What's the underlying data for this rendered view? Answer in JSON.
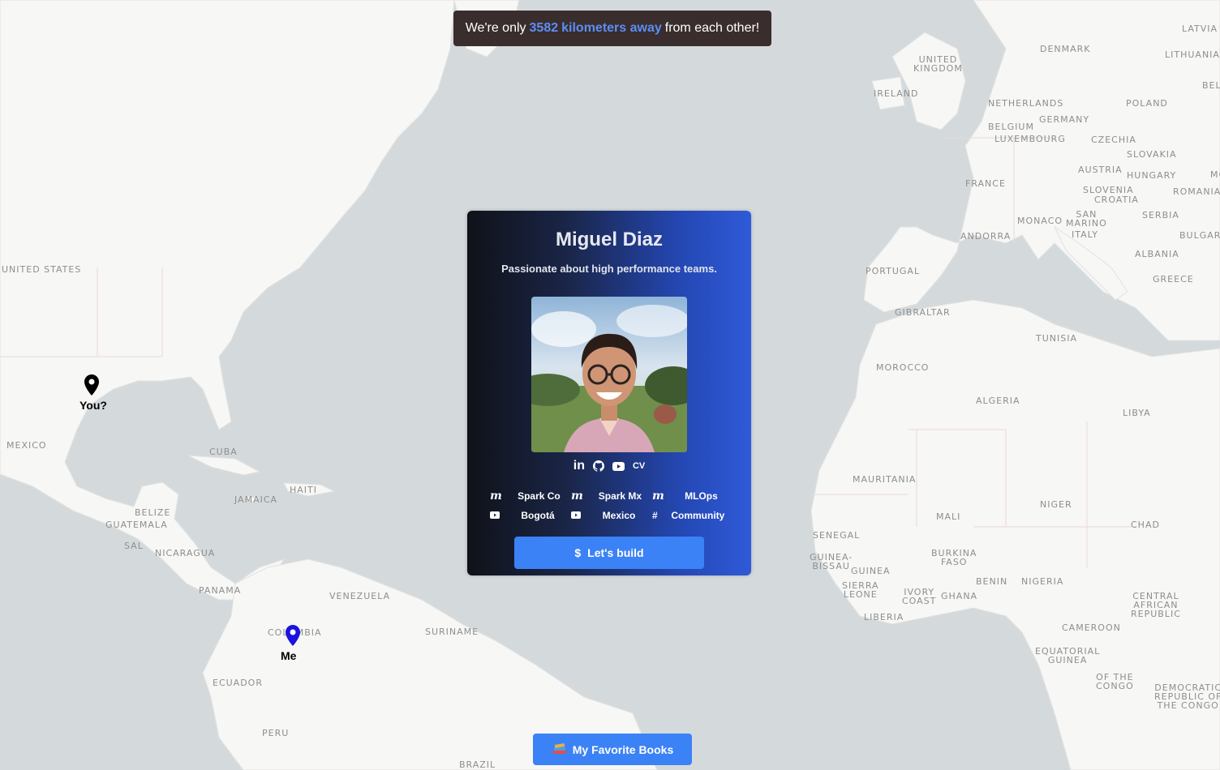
{
  "banner": {
    "prefix": "We're only",
    "distance": "3582",
    "unit": "kilometers away",
    "suffix": "from each other!"
  },
  "profile": {
    "name": "Miguel Diaz",
    "tagline": "Passionate about high performance teams.",
    "socials": {
      "linkedin": "in",
      "cv": "CV"
    },
    "links": [
      {
        "icon": "meetup-icon",
        "label": "Spark Co"
      },
      {
        "icon": "meetup-icon",
        "label": "Spark Mx"
      },
      {
        "icon": "meetup-icon",
        "label": "MLOps"
      },
      {
        "icon": "youtube-icon",
        "label": "Bogotá"
      },
      {
        "icon": "youtube-icon",
        "label": "Mexico"
      },
      {
        "icon": "slack-icon",
        "label": "Community"
      }
    ],
    "cta_label": "Let's build"
  },
  "markers": {
    "visitor": "You?",
    "me": "Me"
  },
  "books_button": {
    "label": "My Favorite Books"
  },
  "map_labels": [
    "UNITED STATES",
    "MEXICO",
    "CUBA",
    "JAMAICA",
    "HAITI",
    "BELIZE",
    "GUATEMALA",
    "SAL",
    "NICARAGUA",
    "PANAMA",
    "VENEZUELA",
    "SURINAME",
    "COLOMBIA",
    "ECUADOR",
    "PERU",
    "BRAZIL",
    "UNITED\nKINGDOM",
    "IRELAND",
    "DENMARK",
    "LATVIA",
    "LITHUANIA",
    "BEL",
    "NETHERLANDS",
    "POLAND",
    "GERMANY",
    "BELGIUM",
    "LUXEMBOURG",
    "CZECHIA",
    "SLOVAKIA",
    "AUSTRIA",
    "HUNGARY",
    "MO",
    "FRANCE",
    "SLOVENIA",
    "CROATIA",
    "ROMANIA",
    "SERBIA",
    "SAN\nMARINO",
    "MONACO",
    "ANDORRA",
    "ITALY",
    "BULGAR",
    "PORTUGAL",
    "ALBANIA",
    "GREECE",
    "GIBRALTAR",
    "TUNISIA",
    "MOROCCO",
    "ALGERIA",
    "LIBYA",
    "MAURITANIA",
    "NIGER",
    "MALI",
    "CHAD",
    "SENEGAL",
    "GUINEA-\nBISSAU",
    "GUINEA",
    "BURKINA\nFASO",
    "BENIN",
    "NIGERIA",
    "SIERRA\nLEONE",
    "IVORY\nCOAST",
    "GHANA",
    "CENTRAL\nAFRICAN\nREPUBLIC",
    "LIBERIA",
    "CAMEROON",
    "EQUATORIAL\nGUINEA",
    "OF THE\nCONGO",
    "DEMOCRATIC\nREPUBLIC OF\nTHE CONGO"
  ],
  "colors": {
    "ocean": "#d4dadc",
    "land": "#f7f7f6",
    "cta": "#3b82f6",
    "banner_bg": "#3a2d2e",
    "highlight": "#5b8ef5",
    "me_pin": "#1a12e0"
  }
}
